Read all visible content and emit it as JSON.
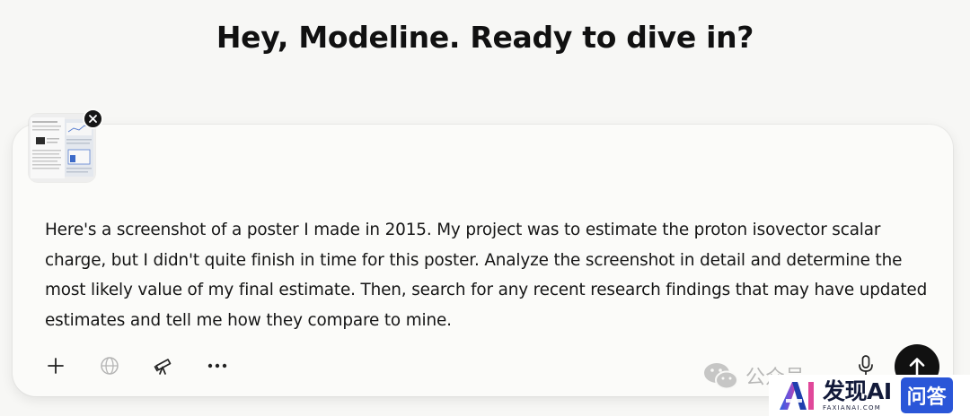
{
  "greeting": "Hey, Modeline. Ready to dive in?",
  "composer": {
    "attachment": {
      "type": "screenshot thumbnail",
      "remove_icon": "close-icon"
    },
    "message": "Here's a screenshot of a poster I made in 2015. My project was to estimate the proton isovector scalar charge, but I didn't quite finish in time for this poster. Analyze the screenshot in detail and determine the most likely value of my final estimate. Then, search for any recent research findings that may have updated estimates and tell me how they compare to mine.",
    "toolbar": {
      "add_icon": "plus-icon",
      "search_icon": "globe-icon",
      "research_icon": "telescope-icon",
      "more_icon": "ellipsis-icon",
      "voice_icon": "microphone-icon",
      "send_icon": "arrow-up-icon"
    }
  },
  "watermark": {
    "icon": "wechat-icon",
    "text": "公众号"
  },
  "brand": {
    "name": "发现AI",
    "domain": "FAXIANAI.COM",
    "tag": "问答"
  },
  "colors": {
    "background": "#f7f7f5",
    "send_button": "#111111",
    "brand_blue": "#2a56d8",
    "brand_navy": "#121a3a"
  }
}
